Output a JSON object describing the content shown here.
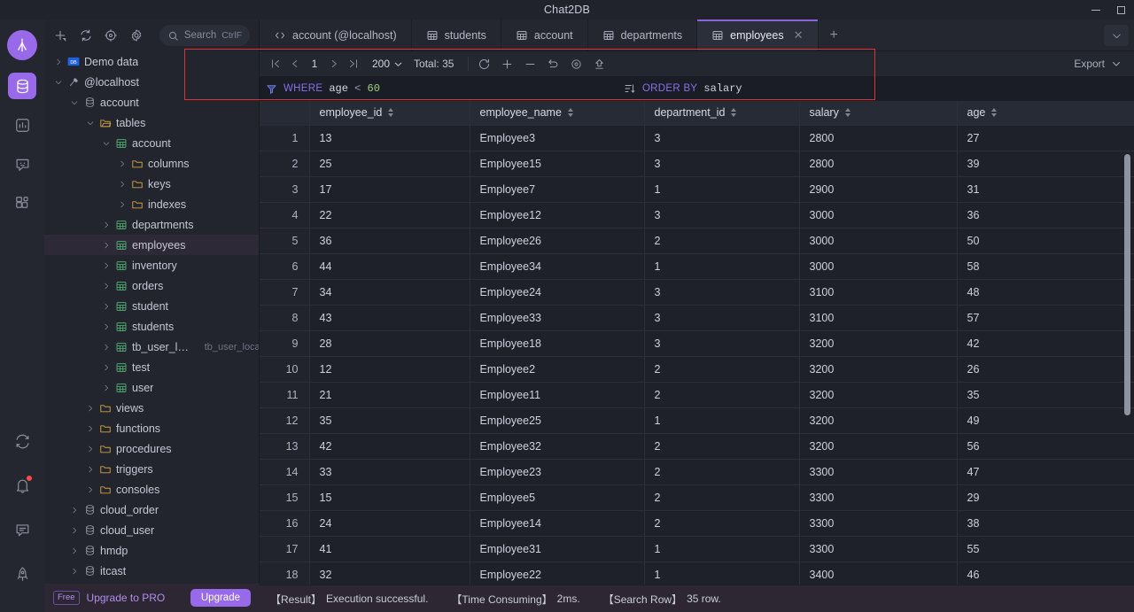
{
  "window": {
    "title": "Chat2DB",
    "minimize_label": "Minimize",
    "maximize_label": "Maximize"
  },
  "rail": {
    "logo_icon": "chat2db-logo-icon",
    "items": [
      {
        "name": "database-icon",
        "label": "Database",
        "active": true
      },
      {
        "name": "dashboard-chart-icon",
        "label": "Dashboard",
        "active": false
      },
      {
        "name": "ai-chat-icon",
        "label": "AI Chat",
        "active": false
      },
      {
        "name": "apps-grid-icon",
        "label": "Workspace",
        "active": false
      }
    ],
    "bottom_items": [
      {
        "name": "sync-icon",
        "label": "Sync"
      },
      {
        "name": "bell-icon",
        "label": "Notifications",
        "badge": true
      },
      {
        "name": "feedback-icon",
        "label": "Feedback"
      },
      {
        "name": "rocket-icon",
        "label": "Upgrade"
      }
    ]
  },
  "sidebar": {
    "toolbar": [
      {
        "name": "add-icon",
        "label": "New"
      },
      {
        "name": "refresh-icon",
        "label": "Refresh"
      },
      {
        "name": "locate-icon",
        "label": "Locate"
      },
      {
        "name": "gear-icon",
        "label": "Settings"
      }
    ],
    "search": {
      "placeholder": "Search",
      "shortcut": "CtrlF"
    },
    "tree": [
      {
        "depth": 0,
        "caret": "right",
        "icon": "demo-badge-icon",
        "label": "Demo data"
      },
      {
        "depth": 0,
        "caret": "down",
        "icon": "connection-icon",
        "label": "@localhost"
      },
      {
        "depth": 1,
        "caret": "down",
        "icon": "database-icon",
        "label": "account"
      },
      {
        "depth": 2,
        "caret": "down",
        "icon": "folder-open-icon",
        "label": "tables"
      },
      {
        "depth": 3,
        "caret": "down",
        "icon": "table-icon",
        "label": "account"
      },
      {
        "depth": 4,
        "caret": "right",
        "icon": "folder-icon",
        "label": "columns"
      },
      {
        "depth": 4,
        "caret": "right",
        "icon": "folder-icon",
        "label": "keys"
      },
      {
        "depth": 4,
        "caret": "right",
        "icon": "folder-icon",
        "label": "indexes"
      },
      {
        "depth": 3,
        "caret": "right",
        "icon": "table-icon",
        "label": "departments"
      },
      {
        "depth": 3,
        "caret": "right",
        "icon": "table-icon",
        "label": "employees",
        "selected": true
      },
      {
        "depth": 3,
        "caret": "right",
        "icon": "table-icon",
        "label": "inventory"
      },
      {
        "depth": 3,
        "caret": "right",
        "icon": "table-icon",
        "label": "orders"
      },
      {
        "depth": 3,
        "caret": "right",
        "icon": "table-icon",
        "label": "student"
      },
      {
        "depth": 3,
        "caret": "right",
        "icon": "table-icon",
        "label": "students"
      },
      {
        "depth": 3,
        "caret": "right",
        "icon": "table-icon",
        "label": "tb_user_local",
        "sub": "tb_user_local"
      },
      {
        "depth": 3,
        "caret": "right",
        "icon": "table-icon",
        "label": "test"
      },
      {
        "depth": 3,
        "caret": "right",
        "icon": "table-icon",
        "label": "user"
      },
      {
        "depth": 2,
        "caret": "right",
        "icon": "folder-icon",
        "label": "views"
      },
      {
        "depth": 2,
        "caret": "right",
        "icon": "folder-icon",
        "label": "functions"
      },
      {
        "depth": 2,
        "caret": "right",
        "icon": "folder-icon",
        "label": "procedures"
      },
      {
        "depth": 2,
        "caret": "right",
        "icon": "folder-icon",
        "label": "triggers"
      },
      {
        "depth": 2,
        "caret": "right",
        "icon": "folder-icon",
        "label": "consoles"
      },
      {
        "depth": 1,
        "caret": "right",
        "icon": "database-icon",
        "label": "cloud_order"
      },
      {
        "depth": 1,
        "caret": "right",
        "icon": "database-icon",
        "label": "cloud_user"
      },
      {
        "depth": 1,
        "caret": "right",
        "icon": "database-icon",
        "label": "hmdp"
      },
      {
        "depth": 1,
        "caret": "right",
        "icon": "database-icon",
        "label": "itcast"
      }
    ],
    "upgrade": {
      "plan_chip": "Free",
      "text": "Upgrade to PRO",
      "button": "Upgrade"
    }
  },
  "tabs": {
    "items": [
      {
        "icon": "code-icon",
        "label": "account (@localhost)",
        "active": false,
        "closable": false
      },
      {
        "icon": "table-icon",
        "label": "students",
        "active": false,
        "closable": false
      },
      {
        "icon": "table-icon",
        "label": "account",
        "active": false,
        "closable": false
      },
      {
        "icon": "table-icon",
        "label": "departments",
        "active": false,
        "closable": false
      },
      {
        "icon": "table-icon",
        "label": "employees",
        "active": true,
        "closable": true
      }
    ],
    "add_label": "+",
    "overflow_icon": "chevron-down-icon"
  },
  "result_toolbar": {
    "page_first_icon": "page-first-icon",
    "page_prev_icon": "page-prev-icon",
    "page_number": "1",
    "page_next_icon": "page-next-icon",
    "page_last_icon": "page-last-icon",
    "page_size": "200",
    "total_label": "Total:",
    "total_value": "35",
    "actions": [
      {
        "name": "refresh-icon",
        "label": "Refresh"
      },
      {
        "name": "add-row-icon",
        "label": "Add row"
      },
      {
        "name": "delete-row-icon",
        "label": "Delete row"
      },
      {
        "name": "revert-icon",
        "label": "Revert"
      },
      {
        "name": "preview-icon",
        "label": "Preview"
      },
      {
        "name": "execute-upload-icon",
        "label": "Execute"
      }
    ],
    "export_label": "Export",
    "export_chevron_icon": "chevron-down-icon"
  },
  "filter_bar": {
    "filter_icon": "filter-icon",
    "where_label": "WHERE",
    "where_expr": {
      "ident": "age",
      "op": "<",
      "num": "60"
    },
    "sort_icon": "sort-icon",
    "orderby_label": "ORDER BY",
    "orderby_expr": "salary"
  },
  "grid": {
    "row_number_header": "",
    "columns": [
      {
        "key": "employee_id",
        "label": "employee_id",
        "sortable": true
      },
      {
        "key": "employee_name",
        "label": "employee_name",
        "sortable": true
      },
      {
        "key": "department_id",
        "label": "department_id",
        "sortable": true
      },
      {
        "key": "salary",
        "label": "salary",
        "sortable": true
      },
      {
        "key": "age",
        "label": "age",
        "sortable": true
      }
    ],
    "rows": [
      {
        "n": "1",
        "employee_id": "13",
        "employee_name": "Employee3",
        "department_id": "3",
        "salary": "2800",
        "age": "27"
      },
      {
        "n": "2",
        "employee_id": "25",
        "employee_name": "Employee15",
        "department_id": "3",
        "salary": "2800",
        "age": "39"
      },
      {
        "n": "3",
        "employee_id": "17",
        "employee_name": "Employee7",
        "department_id": "1",
        "salary": "2900",
        "age": "31"
      },
      {
        "n": "4",
        "employee_id": "22",
        "employee_name": "Employee12",
        "department_id": "3",
        "salary": "3000",
        "age": "36"
      },
      {
        "n": "5",
        "employee_id": "36",
        "employee_name": "Employee26",
        "department_id": "2",
        "salary": "3000",
        "age": "50"
      },
      {
        "n": "6",
        "employee_id": "44",
        "employee_name": "Employee34",
        "department_id": "1",
        "salary": "3000",
        "age": "58"
      },
      {
        "n": "7",
        "employee_id": "34",
        "employee_name": "Employee24",
        "department_id": "3",
        "salary": "3100",
        "age": "48"
      },
      {
        "n": "8",
        "employee_id": "43",
        "employee_name": "Employee33",
        "department_id": "3",
        "salary": "3100",
        "age": "57"
      },
      {
        "n": "9",
        "employee_id": "28",
        "employee_name": "Employee18",
        "department_id": "3",
        "salary": "3200",
        "age": "42"
      },
      {
        "n": "10",
        "employee_id": "12",
        "employee_name": "Employee2",
        "department_id": "2",
        "salary": "3200",
        "age": "26"
      },
      {
        "n": "11",
        "employee_id": "21",
        "employee_name": "Employee11",
        "department_id": "2",
        "salary": "3200",
        "age": "35"
      },
      {
        "n": "12",
        "employee_id": "35",
        "employee_name": "Employee25",
        "department_id": "1",
        "salary": "3200",
        "age": "49"
      },
      {
        "n": "13",
        "employee_id": "42",
        "employee_name": "Employee32",
        "department_id": "2",
        "salary": "3200",
        "age": "56"
      },
      {
        "n": "14",
        "employee_id": "33",
        "employee_name": "Employee23",
        "department_id": "2",
        "salary": "3300",
        "age": "47"
      },
      {
        "n": "15",
        "employee_id": "15",
        "employee_name": "Employee5",
        "department_id": "2",
        "salary": "3300",
        "age": "29"
      },
      {
        "n": "16",
        "employee_id": "24",
        "employee_name": "Employee14",
        "department_id": "2",
        "salary": "3300",
        "age": "38"
      },
      {
        "n": "17",
        "employee_id": "41",
        "employee_name": "Employee31",
        "department_id": "1",
        "salary": "3300",
        "age": "55"
      },
      {
        "n": "18",
        "employee_id": "32",
        "employee_name": "Employee22",
        "department_id": "1",
        "salary": "3400",
        "age": "46"
      }
    ]
  },
  "statusbar": {
    "result_key": "【Result】",
    "result_value": "Execution successful.",
    "time_key": "【Time Consuming】",
    "time_value": "2ms.",
    "rows_key": "【Search Row】",
    "rows_value": "35 row."
  },
  "colors": {
    "accent": "#9869e8",
    "annotation": "#e03131",
    "keyword": "#8a6fe8",
    "number_literal": "#9fd07a",
    "table_icon": "#4cab6d",
    "folder_icon": "#d0a23c"
  }
}
